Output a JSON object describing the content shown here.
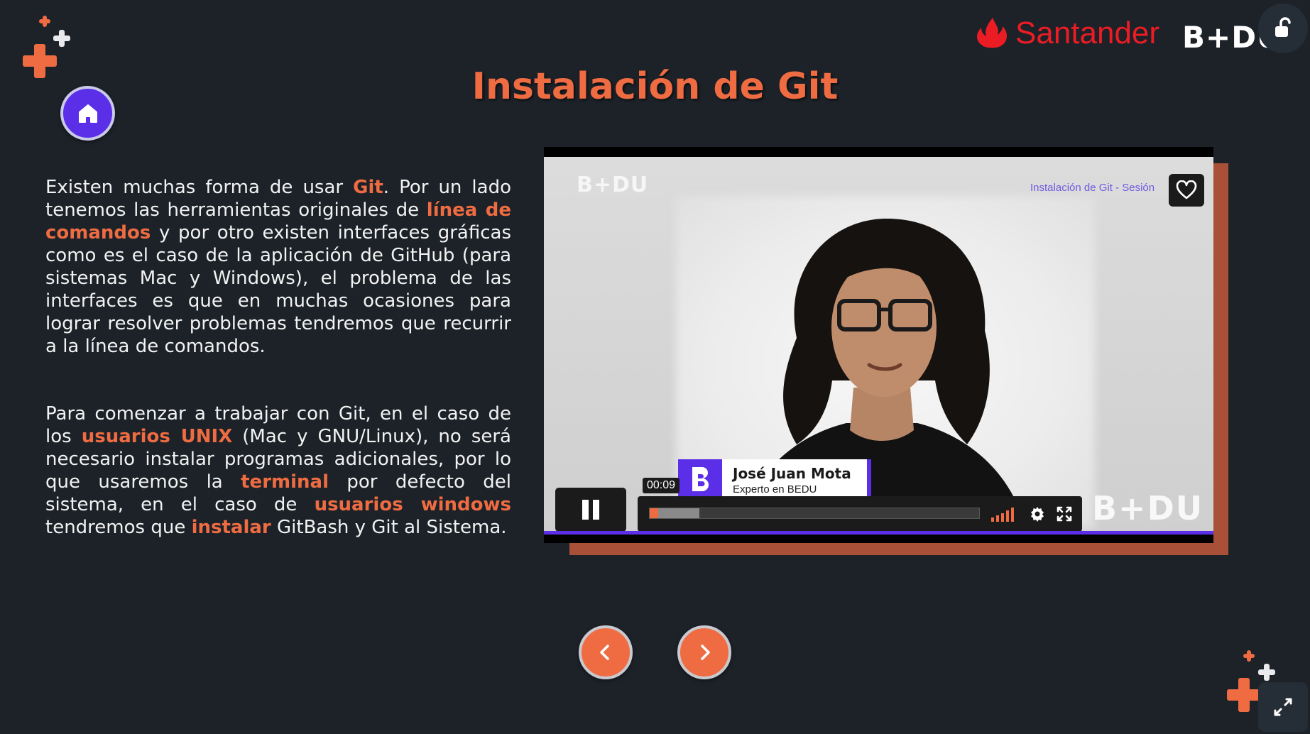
{
  "header": {
    "brand_santander": "Santander",
    "brand_bedu": "B+DU",
    "title": "Instalación de Git"
  },
  "icons": {
    "home": "home-icon",
    "unlock": "unlock-icon",
    "prev": "chevron-left-icon",
    "next": "chevron-right-icon",
    "expand": "expand-icon",
    "heart": "heart-icon",
    "pause": "pause-icon",
    "volume": "volume-bars-icon",
    "settings": "gear-icon",
    "fullscreen": "fullscreen-icon"
  },
  "content": {
    "p1": {
      "t1": "Existen muchas forma de usar ",
      "h1": "Git",
      "t2": ". Por un lado tenemos las herramientas originales de ",
      "h2": "línea de comandos",
      "t3": " y por otro existen interfaces gráficas como es el caso de la aplicación de GitHub (para sistemas Mac y Windows), el problema de las interfaces es que en muchas ocasiones para lograr resolver problemas tendremos que recurrir a la línea de comandos."
    },
    "p2": {
      "t1": "Para comenzar a trabajar con Git, en el caso de los ",
      "h1": "usuarios UNIX",
      "t2": " (Mac y GNU/Linux), no será necesario instalar programas adicionales, por lo que usaremos la ",
      "h2": "terminal",
      "t3": " por defecto del sistema, en el caso de ",
      "h3": "usuarios windows",
      "t4": " tendremos que ",
      "h4": "instalar",
      "t5": " GitBash y Git al Sistema."
    }
  },
  "video": {
    "title": "Instalación de Git - Sesión",
    "watermark": "B+DU",
    "presenter_name": "José Juan Mota",
    "presenter_role": "Experto en BEDU",
    "time": "00:09",
    "progress": 0.025,
    "buffered": 0.15,
    "state": "playing"
  },
  "colors": {
    "accent": "#ef6c42",
    "purple": "#5b2ee8",
    "background": "#1c2228",
    "santander_red": "#ec1c24"
  }
}
